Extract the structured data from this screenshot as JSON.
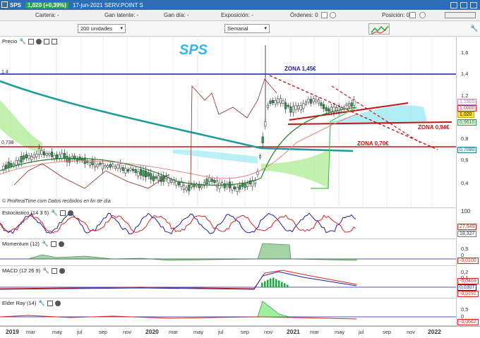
{
  "titlebar": {
    "symbol": "SPS",
    "price": "1,020 (+0,39%)",
    "date_info": "17-jun-2021  SERV.POINT S"
  },
  "infobar": {
    "cartera": "Cartera: -",
    "ganancia_latente": "Gan latente: -",
    "ganancia_dia": "Gan día: -",
    "exposicion": "Exposición: -",
    "ordenes": "Órdenes: 0",
    "posicion": "Posición: 0"
  },
  "toolbar": {
    "units": "200 unidades",
    "period": "Semanal"
  },
  "price_panel": {
    "label": "Precio",
    "title": "SPS",
    "watermark": "© ProRealTime.com  Datos recibidos en fin de día",
    "line_label_left_top": "1,4",
    "line_label_left_mid": "0,738",
    "zones": {
      "z145": "ZONA 1,45€",
      "z094": "ZONA 0,94€",
      "z070": "ZONA 0,70€"
    },
    "y_ticks": [
      "1,6",
      "1,4",
      "1,2",
      "0,8",
      "0,6",
      "0,4"
    ],
    "tags": [
      "1,1905",
      "1,0000",
      "1,020",
      "0,9610",
      "0,7080"
    ]
  },
  "stoch_panel": {
    "label": "Estocástico (14 3 5)",
    "y_ticks": [
      "100"
    ],
    "tags": [
      "27,949",
      "18,327"
    ]
  },
  "momentum_panel": {
    "label": "Momentum (12)",
    "y_ticks": [
      "0,5",
      "0"
    ],
    "tags": [
      "-0,0100"
    ]
  },
  "macd_panel": {
    "label": "MACD (12 26 9)",
    "y_ticks": [
      "0,2",
      "0,1"
    ],
    "tags": [
      "-0,0469",
      "0,0307",
      "-0,0191"
    ]
  },
  "elder_panel": {
    "label": "Elder Ray (14)",
    "y_ticks": [
      "0,5",
      "0"
    ],
    "tags": [
      "-0,0662"
    ]
  },
  "xaxis": {
    "labels": [
      {
        "t": "2019",
        "year": true
      },
      {
        "t": "mar"
      },
      {
        "t": "may"
      },
      {
        "t": "jul"
      },
      {
        "t": "sep"
      },
      {
        "t": "nov"
      },
      {
        "t": "2020",
        "year": true
      },
      {
        "t": "mar"
      },
      {
        "t": "may"
      },
      {
        "t": "jul"
      },
      {
        "t": "sep"
      },
      {
        "t": "nov"
      },
      {
        "t": "2021",
        "year": true
      },
      {
        "t": "mar"
      },
      {
        "t": "may"
      },
      {
        "t": "jul"
      },
      {
        "t": "sep"
      },
      {
        "t": "nov"
      },
      {
        "t": "2022",
        "year": true
      }
    ]
  },
  "colors": {
    "accent": "#2d6db5",
    "up": "#2aa34a",
    "down": "#d22",
    "zone_blue": "#1d1daa",
    "zone_red": "#c81414"
  }
}
